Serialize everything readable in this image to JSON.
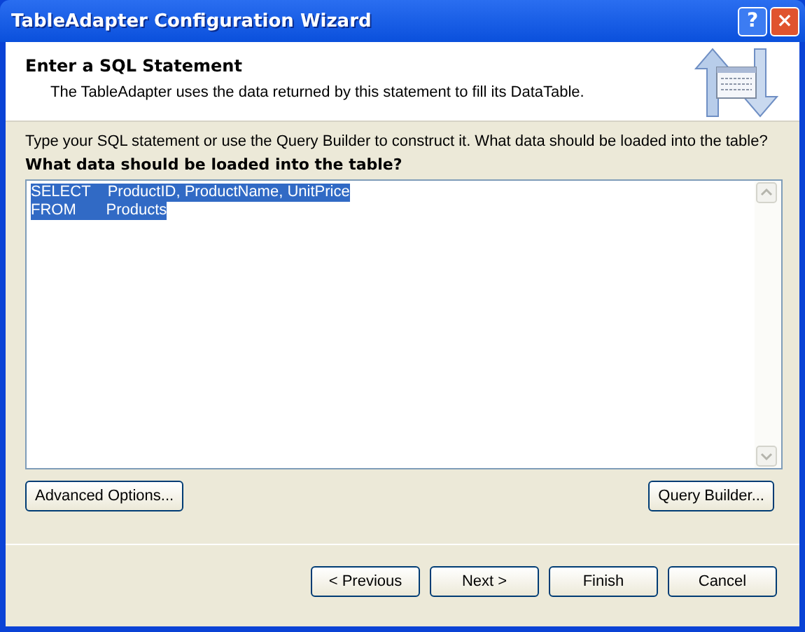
{
  "window": {
    "title": "TableAdapter Configuration Wizard",
    "help_button": "?",
    "close_button": "×"
  },
  "header": {
    "title": "Enter a SQL Statement",
    "description": "The TableAdapter uses the data returned by this statement to fill its DataTable."
  },
  "instructions": "Type your SQL statement or use the Query Builder to construct it. What data should be loaded into the table?",
  "sql_label": "What data should be loaded into the table?",
  "sql_editor": {
    "selected": true,
    "lines": [
      "SELECT    ProductID, ProductName, UnitPrice",
      "FROM       Products"
    ]
  },
  "option_buttons": [
    "Advanced Options...",
    "Query Builder..."
  ],
  "nav_buttons": [
    "< Previous",
    "Next >",
    "Finish",
    "Cancel"
  ]
}
